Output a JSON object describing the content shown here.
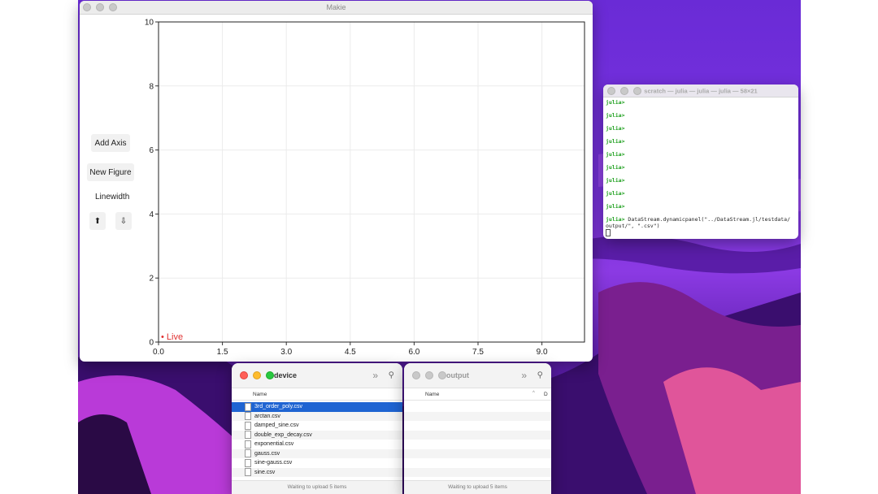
{
  "makie": {
    "title": "Makie",
    "buttons": {
      "add_axis": "Add Axis",
      "new_figure": "New Figure",
      "up": "⬆",
      "down": "⇩"
    },
    "linewidth_label": "Linewidth",
    "legend_label": "• Live"
  },
  "chart_data": {
    "type": "line",
    "series": [],
    "xlim": [
      0,
      10
    ],
    "ylim": [
      0,
      10
    ],
    "xticks": [
      "0.0",
      "1.5",
      "3.0",
      "4.5",
      "6.0",
      "7.5",
      "9.0"
    ],
    "yticks": [
      "0",
      "2",
      "4",
      "6",
      "8",
      "10"
    ],
    "grid": true,
    "legend": {
      "entries": [
        "Live"
      ],
      "placement": "bottom-left",
      "color": "#e03030"
    }
  },
  "terminal": {
    "title": "scratch — julia — julia — julia — 58×21",
    "prompt": "julia>",
    "empty_prompts": 9,
    "command": "DataStream.dynamicpanel(\"../DataStream.jl/testdata/",
    "command_cont": "output/\", \".csv\")"
  },
  "finder_device": {
    "title": "device",
    "column": "Name",
    "files": [
      "3rd_order_poly.csv",
      "arctan.csv",
      "damped_sine.csv",
      "double_exp_decay.csv",
      "exponential.csv",
      "gauss.csv",
      "sine-gauss.csv",
      "sine.csv"
    ],
    "selected_index": 0,
    "status": "Waiting to upload 5 items"
  },
  "finder_output": {
    "title": "output",
    "column": "Name",
    "column2": "D",
    "status": "Waiting to upload 5 items"
  },
  "colors": {
    "accent": "#1f64d2",
    "live": "#e03030",
    "prompt": "#1a9e1a"
  }
}
